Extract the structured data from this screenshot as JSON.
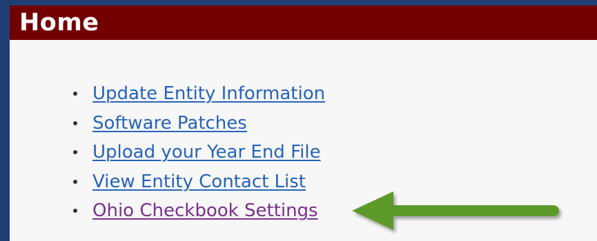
{
  "header": {
    "title": "Home"
  },
  "links": [
    {
      "label": "Update Entity Information",
      "color": "#2563b8"
    },
    {
      "label": "Software Patches",
      "color": "#2563b8"
    },
    {
      "label": "Upload your Year End File",
      "color": "#2563b8"
    },
    {
      "label": "View Entity Contact List",
      "color": "#2563b8"
    },
    {
      "label": "Ohio Checkbook Settings",
      "color": "#7a2f8c",
      "visited": true
    }
  ],
  "annotation": {
    "icon": "green-arrow-left-icon",
    "color": "#5d9a2c"
  },
  "colors": {
    "header_bg": "#720000",
    "frame_border": "#1f3f74",
    "page_bg": "#f7f7f7"
  }
}
